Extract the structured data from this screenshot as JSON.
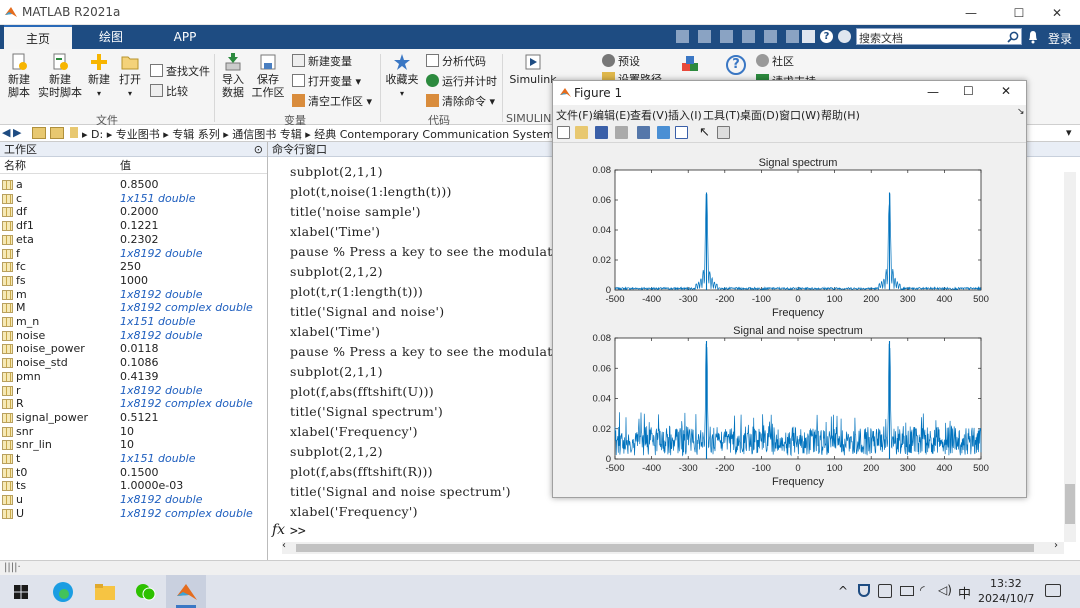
{
  "app": {
    "title": "MATLAB R2021a",
    "minimize": "—",
    "maximize": "☐",
    "close": "✕"
  },
  "ribbon_tabs": [
    "主页",
    "绘图",
    "APP"
  ],
  "search": {
    "placeholder": "搜索文档",
    "login": "登录"
  },
  "ribbon": {
    "new_script": "新建\n脚本",
    "new_live": "新建\n实时脚本",
    "new": "新建",
    "open": "打开",
    "find_files": "查找文件",
    "compare": "比较",
    "import": "导入\n数据",
    "save_ws": "保存\n工作区",
    "new_var": "新建变量",
    "open_var": "打开变量",
    "clear_ws": "清空工作区",
    "favorites": "收藏夹",
    "analyze": "分析代码",
    "run_time": "运行并计时",
    "clear_cmd": "清除命令",
    "simulink": "Simulink",
    "prefs": "预设",
    "set_path": "设置路径",
    "community": "社区",
    "request_support": "请求支持",
    "group_file": "文件",
    "group_var": "变量",
    "group_code": "代码",
    "group_sim": "SIMULINK"
  },
  "address": {
    "drive": "D:",
    "path": "▸ D: ▸ 专业图书 ▸ 专辑 系列 ▸ 通信图书 专辑 ▸ 经典 Contemporary Communication Systems usin"
  },
  "workspace": {
    "title": "工作区",
    "col_name": "名称",
    "col_value": "值",
    "vars": [
      {
        "name": "a",
        "value": "0.8500",
        "italic": false
      },
      {
        "name": "c",
        "value": "1x151 double",
        "italic": true
      },
      {
        "name": "df",
        "value": "0.2000",
        "italic": false
      },
      {
        "name": "df1",
        "value": "0.1221",
        "italic": false
      },
      {
        "name": "eta",
        "value": "0.2302",
        "italic": false
      },
      {
        "name": "f",
        "value": "1x8192 double",
        "italic": true
      },
      {
        "name": "fc",
        "value": "250",
        "italic": false
      },
      {
        "name": "fs",
        "value": "1000",
        "italic": false
      },
      {
        "name": "m",
        "value": "1x8192 double",
        "italic": true
      },
      {
        "name": "M",
        "value": "1x8192 complex double",
        "italic": true
      },
      {
        "name": "m_n",
        "value": "1x151 double",
        "italic": true
      },
      {
        "name": "noise",
        "value": "1x8192 double",
        "italic": true
      },
      {
        "name": "noise_power",
        "value": "0.0118",
        "italic": false
      },
      {
        "name": "noise_std",
        "value": "0.1086",
        "italic": false
      },
      {
        "name": "pmn",
        "value": "0.4139",
        "italic": false
      },
      {
        "name": "r",
        "value": "1x8192 double",
        "italic": true
      },
      {
        "name": "R",
        "value": "1x8192 complex double",
        "italic": true
      },
      {
        "name": "signal_power",
        "value": "0.5121",
        "italic": false
      },
      {
        "name": "snr",
        "value": "10",
        "italic": false
      },
      {
        "name": "snr_lin",
        "value": "10",
        "italic": false
      },
      {
        "name": "t",
        "value": "1x151 double",
        "italic": true
      },
      {
        "name": "t0",
        "value": "0.1500",
        "italic": false
      },
      {
        "name": "ts",
        "value": "1.0000e-03",
        "italic": false
      },
      {
        "name": "u",
        "value": "1x8192 double",
        "italic": true
      },
      {
        "name": "U",
        "value": "1x8192 complex double",
        "italic": true
      }
    ]
  },
  "command_window": {
    "title": "命令行窗口",
    "lines": [
      "subplot(2,1,1)",
      "plot(t,noise(1:length(t)))",
      "title('noise sample')",
      "xlabel('Time')",
      "pause  % Press a key to see the modulat",
      "subplot(2,1,2)",
      "plot(t,r(1:length(t)))",
      "title('Signal and noise')",
      "xlabel('Time')",
      "pause  % Press a key to see the modulat",
      "subplot(2,1,1)",
      "plot(f,abs(fftshift(U)))",
      "title('Signal spectrum')",
      "xlabel('Frequency')",
      "subplot(2,1,2)",
      "plot(f,abs(fftshift(R)))",
      "title('Signal and noise spectrum')",
      "xlabel('Frequency')"
    ],
    "prompt_symbol": "fx",
    "prompt": ">>"
  },
  "figure": {
    "title": "Figure 1",
    "menu": [
      "文件(F)",
      "编辑(E)",
      "查看(V)",
      "插入(I)",
      "工具(T)",
      "桌面(D)",
      "窗口(W)",
      "帮助(H)"
    ]
  },
  "taskbar": {
    "time": "13:32",
    "date": "2024/10/7",
    "ime": "中"
  },
  "colors": {
    "ribbon_tab_bg": "#1e4c82",
    "plot_line": "#0072bd"
  },
  "chart_data": [
    {
      "type": "line",
      "title": "Signal spectrum",
      "xlabel": "Frequency",
      "ylabel": "",
      "xlim": [
        -500,
        500
      ],
      "ylim": [
        0,
        0.08
      ],
      "xticks": [
        -500,
        -400,
        -300,
        -200,
        -100,
        0,
        100,
        200,
        300,
        400,
        500
      ],
      "yticks": [
        0,
        0.02,
        0.04,
        0.06,
        0.08
      ],
      "peaks": [
        {
          "x": -250,
          "y": 0.065
        },
        {
          "x": 250,
          "y": 0.065
        }
      ],
      "noise_floor": 0.001
    },
    {
      "type": "line",
      "title": "Signal and noise spectrum",
      "xlabel": "Frequency",
      "ylabel": "",
      "xlim": [
        -500,
        500
      ],
      "ylim": [
        0,
        0.08
      ],
      "xticks": [
        -500,
        -400,
        -300,
        -200,
        -100,
        0,
        100,
        200,
        300,
        400,
        500
      ],
      "yticks": [
        0,
        0.02,
        0.04,
        0.06,
        0.08
      ],
      "peaks": [
        {
          "x": -250,
          "y": 0.078
        },
        {
          "x": 250,
          "y": 0.078
        }
      ],
      "noise_floor": 0.012
    }
  ]
}
